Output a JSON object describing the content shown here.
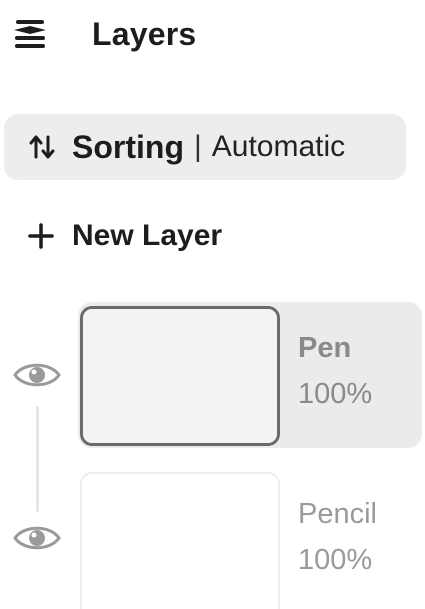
{
  "header": {
    "title": "Layers",
    "icon": "layers-stack-icon"
  },
  "sorting": {
    "label": "Sorting",
    "separator": "|",
    "value": "Automatic",
    "icon": "sort-arrows-icon"
  },
  "new_layer": {
    "label": "New Layer",
    "icon": "plus-icon"
  },
  "layers": [
    {
      "name": "Pen",
      "opacity": "100%",
      "selected": true,
      "visible": true
    },
    {
      "name": "Pencil",
      "opacity": "100%",
      "selected": false,
      "visible": true
    }
  ],
  "colors": {
    "text_primary": "#1d1d1f",
    "pill_bg": "#ededed",
    "selected_row_bg": "#ebebeb",
    "muted_text": "#8a8a8a",
    "eye_icon": "#9a9a9a"
  }
}
